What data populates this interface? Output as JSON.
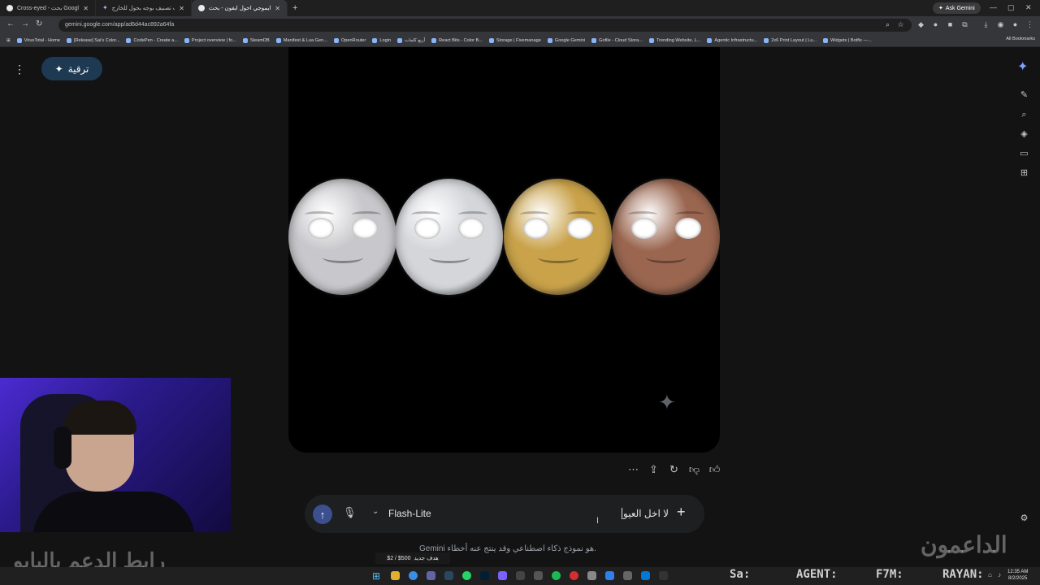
{
  "browser": {
    "tabs": [
      {
        "title": "Cross-eyed - بحث Google",
        "active": false,
        "icon": "google-icon"
      },
      {
        "title": "أيقونات تصنيف بوجه بحول للخارج",
        "active": false,
        "icon": "gemini-icon"
      },
      {
        "title": "ايموجي احول ايفون - بحث Google",
        "active": true,
        "icon": "google-icon"
      }
    ],
    "new_tab": "+",
    "ask_gemini": "Ask Gemini",
    "url": "gemini.google.com/app/ad6d44ac892a64fa",
    "bookmarks": [
      "VirusTotal - Home",
      "[Release] Sai's Color...",
      "CodePen - Create a...",
      "Project overview | fo...",
      "SteamDB",
      "Manifest & Lua Gen...",
      "OpenRouter",
      "Login",
      "أربع كلمات",
      "React Bits - Color B...",
      "Storage | Fivemanage",
      "Google Gemini",
      "Gofile - Cloud Stora...",
      "Trending Website, L...",
      "Agentic Infrastructu...",
      "2x6 Print Layout | Lu...",
      "Widgets | Botfix —..."
    ],
    "all_bookmarks": "All Bookmarks"
  },
  "gemini": {
    "upgrade_label": "ترقية",
    "coins": [
      {
        "name": "silver-coin",
        "color": "#c8c8cc"
      },
      {
        "name": "silver-coin-2",
        "color": "#d4d6da"
      },
      {
        "name": "gold-coin",
        "color": "#c9a24a"
      },
      {
        "name": "bronze-coin",
        "color": "#9a6650"
      }
    ],
    "prompt": {
      "model": "Flash-Lite",
      "text": "لا اخل العيو"
    },
    "disclaimer": "Gemini هو نموذج ذكاء اصطناعي وقد ينتج عنه أخطاء."
  },
  "overlay": {
    "support_link": "رابط الدعم بالبايو",
    "brand": "الداعمون",
    "goal_amount": "$2 / $500",
    "goal_label": "هدف جديد"
  },
  "taskbar": {
    "tickers": [
      {
        "label": "Sa:"
      },
      {
        "label": "AGENT:"
      },
      {
        "label": "F7M:"
      },
      {
        "label": "RAYAN:"
      }
    ],
    "time": "12:35 AM",
    "date": "8/2/2025"
  }
}
